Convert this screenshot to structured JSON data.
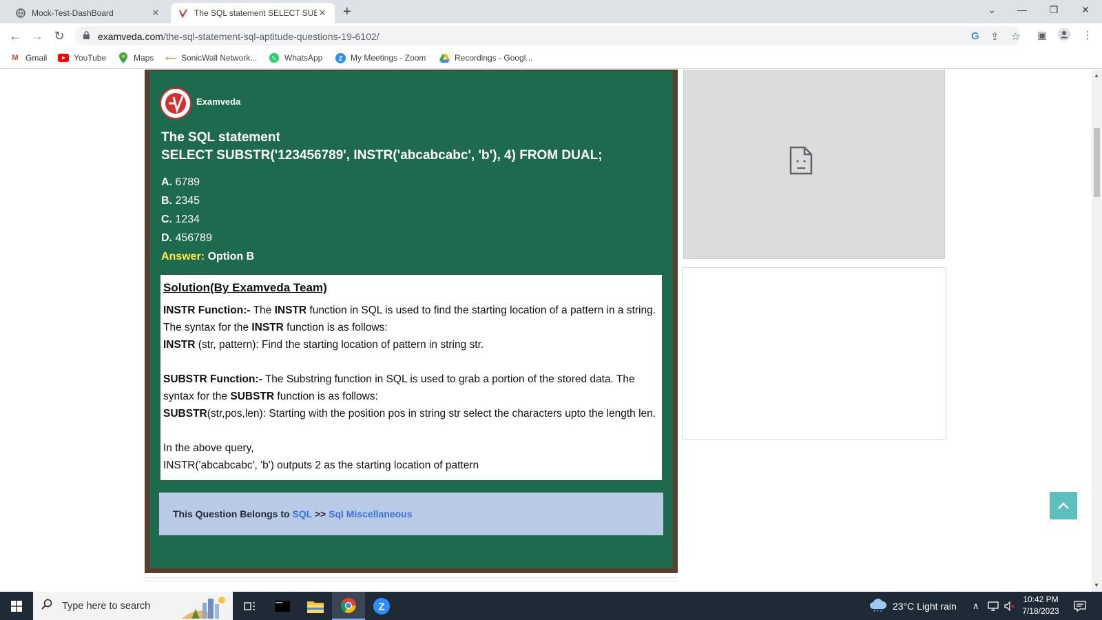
{
  "browser": {
    "tabs": [
      {
        "title": "Mock-Test-DashBoard",
        "active": false
      },
      {
        "title": "The SQL statement SELECT SUBS",
        "active": true
      }
    ],
    "url_host": "examveda.com",
    "url_path": "/the-sql-statement-sql-aptitude-questions-19-6102/",
    "bookmarks": [
      {
        "label": "Gmail",
        "icon": "gmail-icon"
      },
      {
        "label": "YouTube",
        "icon": "youtube-icon"
      },
      {
        "label": "Maps",
        "icon": "maps-icon"
      },
      {
        "label": "SonicWall Network...",
        "icon": "sonicwall-icon"
      },
      {
        "label": "WhatsApp",
        "icon": "whatsapp-icon"
      },
      {
        "label": "My Meetings - Zoom",
        "icon": "zoom-icon"
      },
      {
        "label": "Recordings - Googl...",
        "icon": "google-drive-icon"
      }
    ]
  },
  "question": {
    "brand": "Examveda",
    "title_line1": "The SQL statement",
    "title_line2": "SELECT SUBSTR('123456789', INSTR('abcabcabc', 'b'), 4) FROM DUAL;",
    "options": [
      {
        "key": "A.",
        "text": "6789"
      },
      {
        "key": "B.",
        "text": "2345"
      },
      {
        "key": "C.",
        "text": "1234"
      },
      {
        "key": "D.",
        "text": "456789"
      }
    ],
    "answer_label": "Answer:",
    "answer_value": "Option B"
  },
  "solution": {
    "heading": "Solution(By Examveda Team)",
    "instr_head": "INSTR Function:-",
    "instr_t1": " The ",
    "instr_b1": "INSTR",
    "instr_t2": " function in SQL is used to find the starting location of a pattern in a string. The syntax for the ",
    "instr_b2": "INSTR",
    "instr_t3": " function is as follows:",
    "instr_syntax_b": "INSTR",
    "instr_syntax_t": " (str, pattern): Find the starting location of pattern in string str.",
    "substr_head": "SUBSTR Function:-",
    "substr_t1": " The Substring function in SQL is used to grab a portion of the stored data. The syntax for the ",
    "substr_b1": "SUBSTR",
    "substr_t2": " function is as follows:",
    "substr_syntax_b": "SUBSTR",
    "substr_syntax_t": "(str,pos,len): Starting with the position pos in string str select the characters upto the length len.",
    "query_intro": "In the above query,",
    "query_line": "INSTR('abcabcabc', 'b') outputs 2 as the starting location of pattern"
  },
  "belongs": {
    "prefix": "This Question Belongs to ",
    "link1": "SQL",
    "sep": " >> ",
    "link2": "Sql Miscellaneous"
  },
  "taskbar": {
    "search_placeholder": "Type here to search",
    "weather": "23°C  Light rain",
    "time": "10:42 PM",
    "date": "7/18/2023"
  },
  "colors": {
    "board_green": "#1e6a4e",
    "board_frame": "#5a3d2b",
    "answer_yellow": "#ffeb3b",
    "link_blue": "#3b73d9",
    "belongs_bg": "#b8cae6",
    "totop_teal": "#5bc0be"
  }
}
